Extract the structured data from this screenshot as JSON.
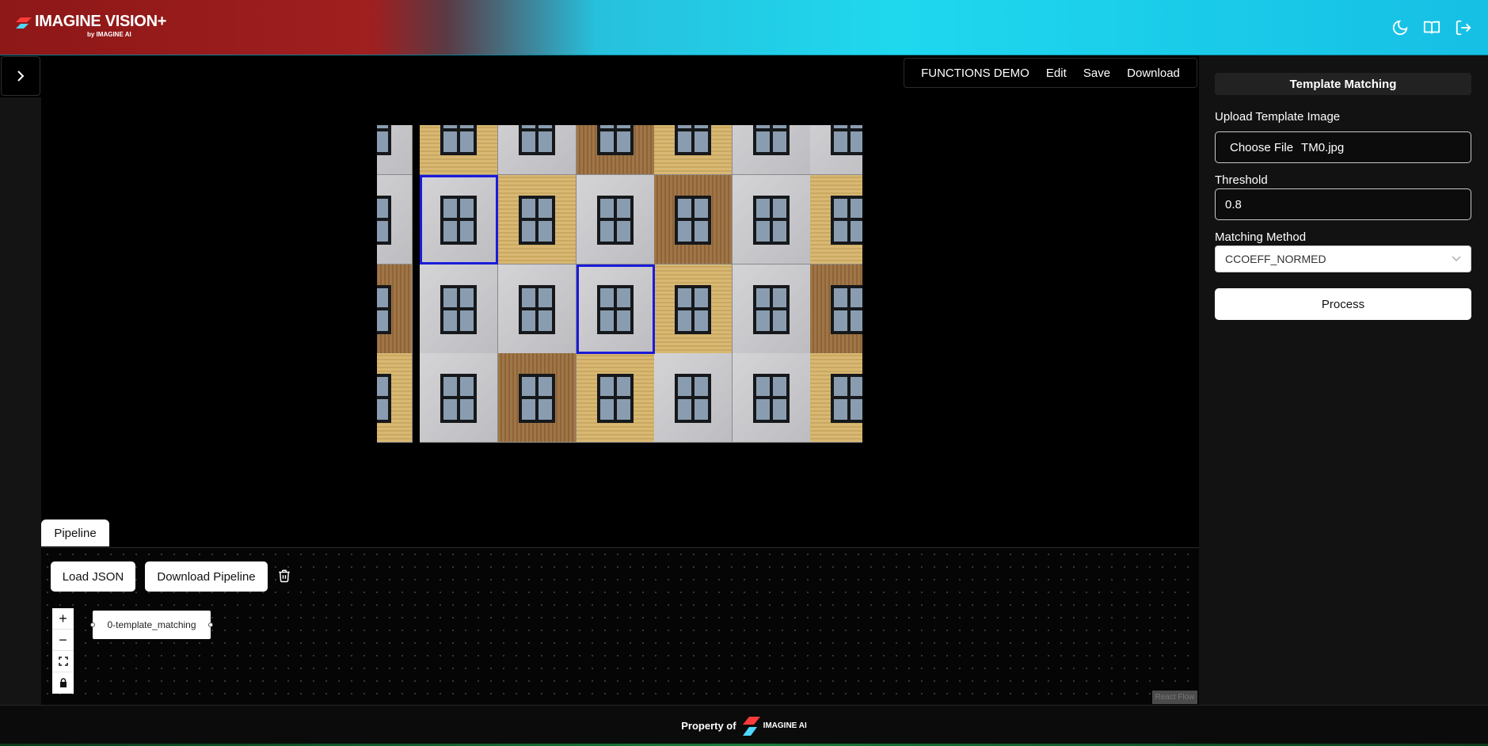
{
  "header": {
    "logo_text": "IMAGINE VISION+",
    "logo_sub": "by IMAGINE AI",
    "icons": [
      "moon-icon",
      "book-icon",
      "logout-icon"
    ]
  },
  "topmenu": {
    "items": [
      "FUNCTIONS DEMO",
      "Edit",
      "Save",
      "Download"
    ]
  },
  "pipeline": {
    "tab_label": "Pipeline",
    "load_json": "Load JSON",
    "download_pipeline": "Download Pipeline",
    "node_label": "0-template_matching",
    "attribution": "React Flow"
  },
  "panel": {
    "title": "Template Matching",
    "upload_label": "Upload Template Image",
    "choose_file": "Choose File",
    "file_name": "TM0.jpg",
    "threshold_label": "Threshold",
    "threshold_value": "0.8",
    "method_label": "Matching Method",
    "method_value": "CCOEFF_NORMED",
    "process_label": "Process"
  },
  "footer": {
    "text": "Property of",
    "logo_text": "IMAGINE AI"
  },
  "colors": {
    "brand_red": "#a01f1f",
    "brand_cyan": "#1fd8ee",
    "match_box": "#1b1bd8"
  }
}
